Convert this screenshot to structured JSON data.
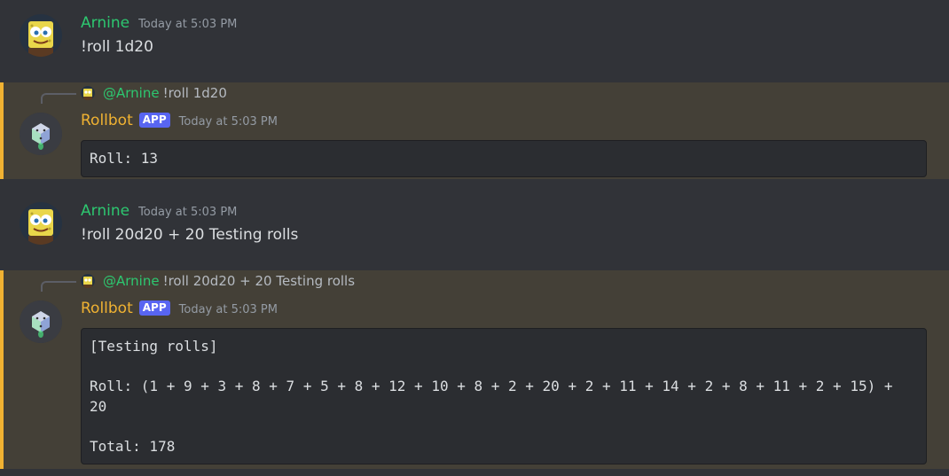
{
  "messages": [
    {
      "author": "Arnine",
      "timestamp": "Today at 5:03 PM",
      "content": "!roll 1d20"
    },
    {
      "reply": {
        "mention": "@Arnine",
        "text": "!roll 1d20"
      },
      "author": "Rollbot",
      "badge": "APP",
      "timestamp": "Today at 5:03 PM",
      "code": "Roll: 13"
    },
    {
      "author": "Arnine",
      "timestamp": "Today at 5:03 PM",
      "content": "!roll 20d20 + 20 Testing rolls"
    },
    {
      "reply": {
        "mention": "@Arnine",
        "text": "!roll 20d20 + 20 Testing rolls"
      },
      "author": "Rollbot",
      "badge": "APP",
      "timestamp": "Today at 5:03 PM",
      "code": "[Testing rolls]\n\nRoll: (1 + 9 + 3 + 8 + 7 + 5 + 8 + 12 + 10 + 8 + 2 + 20 + 2 + 11 + 14 + 2 + 8 + 11 + 2 + 15) + 20\n\nTotal: 178"
    }
  ],
  "colors": {
    "user_name": "#2dc770",
    "bot_name": "#f0b232",
    "mention_bar": "#f0b232",
    "mention_bg": "#444037",
    "badge": "#5865f2"
  },
  "icons": {
    "user_avatar": "spongebob-avatar",
    "bot_avatar": "glowing-dice-avatar"
  }
}
